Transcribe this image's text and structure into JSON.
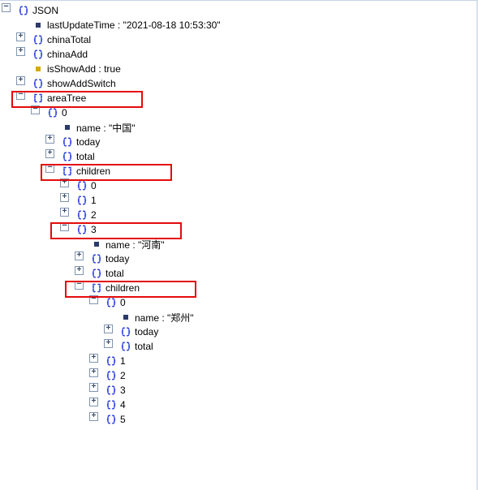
{
  "root": {
    "label": "JSON",
    "lastUpdateTime_key": "lastUpdateTime",
    "lastUpdateTime_val": "\"2021-08-18 10:53:30\"",
    "chinaTotal": "chinaTotal",
    "chinaAdd": "chinaAdd",
    "isShowAdd_key": "isShowAdd",
    "isShowAdd_val": "true",
    "showAddSwitch": "showAddSwitch",
    "areaTree": "areaTree"
  },
  "area0": {
    "idx": "0",
    "name_key": "name",
    "name_val": "\"中国\"",
    "today": "today",
    "total": "total",
    "children": "children"
  },
  "lv1": {
    "i0": "0",
    "i1": "1",
    "i2": "2",
    "i3": "3"
  },
  "prov3": {
    "name_key": "name",
    "name_val": "\"河南\"",
    "today": "today",
    "total": "total",
    "children": "children"
  },
  "city0": {
    "idx": "0",
    "name_key": "name",
    "name_val": "\"郑州\"",
    "today": "today",
    "total": "total"
  },
  "lv2": {
    "i1": "1",
    "i2": "2",
    "i3": "3",
    "i4": "4",
    "i5": "5"
  }
}
